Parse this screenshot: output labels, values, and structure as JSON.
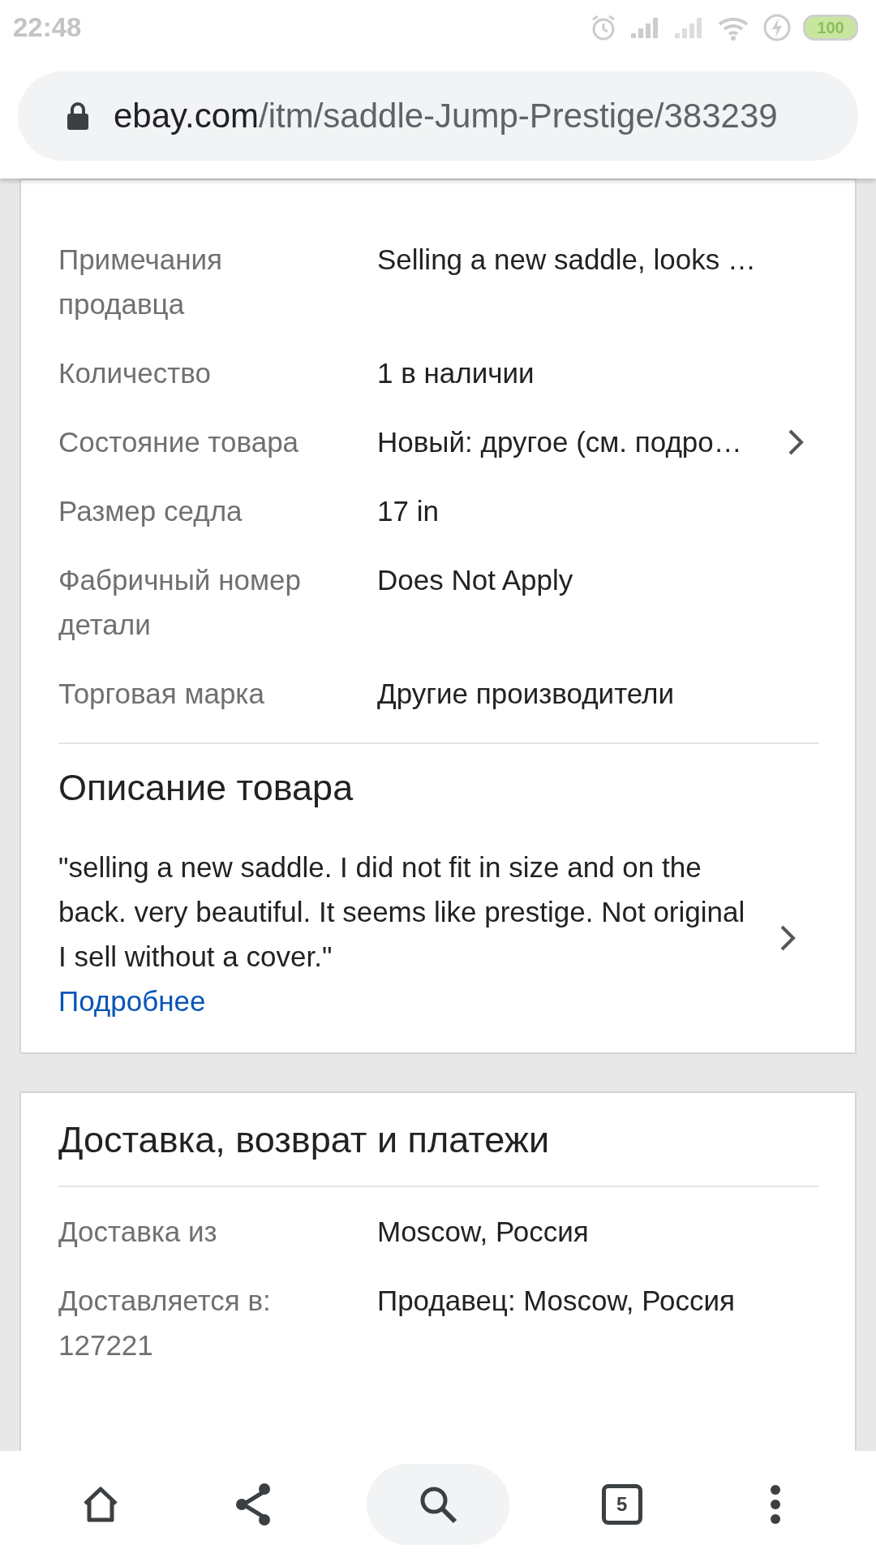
{
  "status_bar": {
    "time": "22:48",
    "battery": "100"
  },
  "address_bar": {
    "domain": "ebay.com",
    "path": "/itm/saddle-Jump-Prestige/383239"
  },
  "item_specifics": {
    "rows": [
      {
        "label": "Примечания продавца",
        "value": "Selling a new saddle, looks …",
        "kind": "plain"
      },
      {
        "label": "Количество",
        "value": "1 в наличии",
        "kind": "plain"
      },
      {
        "label": "Состояние товара",
        "value": "Новый: другое (см. подро…",
        "kind": "detail"
      },
      {
        "label": "Размер седла",
        "value": "17 in",
        "kind": "plain"
      },
      {
        "label": "Фабричный номер детали",
        "value": "Does Not Apply",
        "kind": "plain"
      },
      {
        "label": "Торговая марка",
        "value": "Другие производители",
        "kind": "plain"
      }
    ]
  },
  "description": {
    "title": "Описание товара",
    "text": "\"selling a new saddle. I did not fit in size and on the back. very beautiful. It seems like prestige. Not original I sell without a cover.\"",
    "more_link": "Подробнее"
  },
  "shipping": {
    "title": "Доставка, возврат и платежи",
    "rows": [
      {
        "label": "Доставка из",
        "value": "Moscow, Россия"
      },
      {
        "label": "Доставляется в: 127221",
        "value": "Продавец: Moscow, Россия"
      }
    ]
  },
  "bottom_bar": {
    "tab_count": "5"
  }
}
